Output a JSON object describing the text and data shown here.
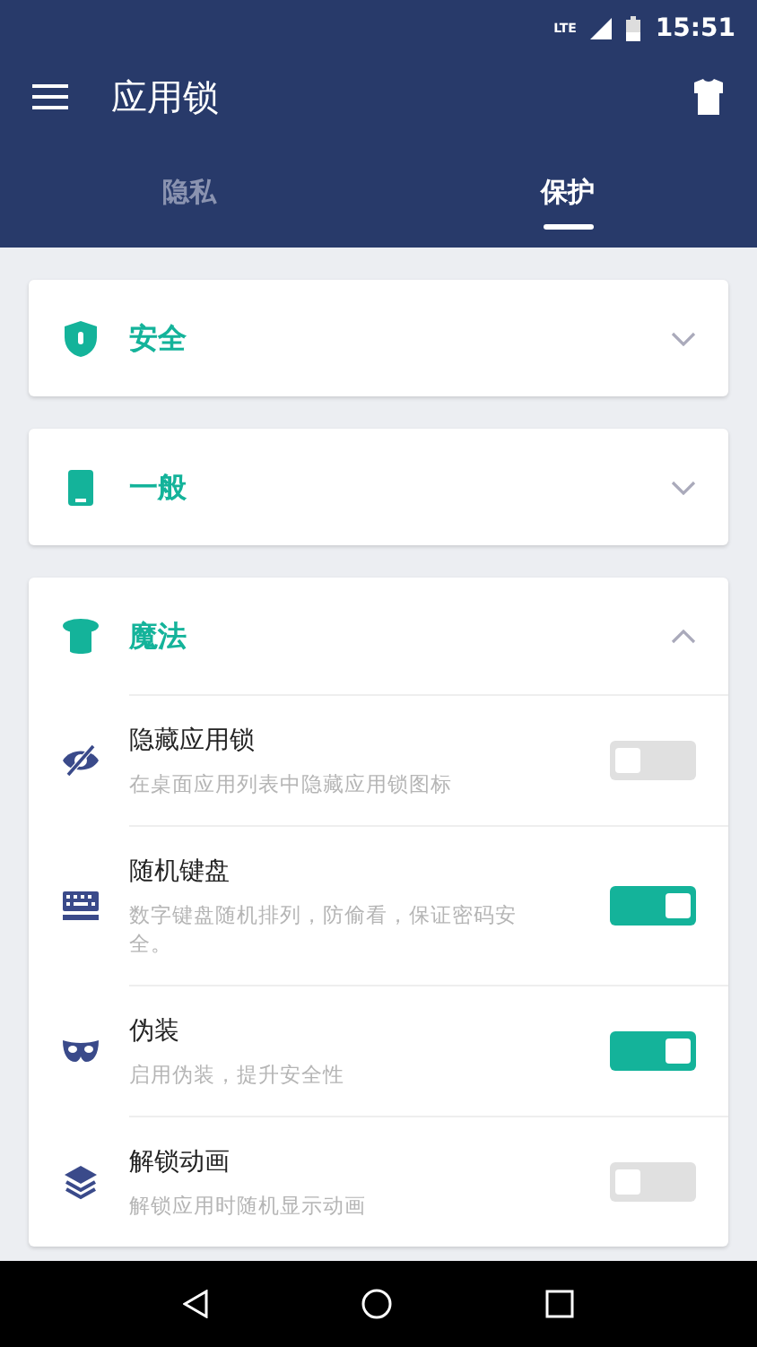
{
  "status_bar": {
    "network": "LTE",
    "time": "15:51"
  },
  "toolbar": {
    "title": "应用锁"
  },
  "tabs": [
    {
      "label": "隐私",
      "selected": false
    },
    {
      "label": "保护",
      "selected": true
    }
  ],
  "sections": [
    {
      "kind": "shield",
      "title": "安全",
      "expanded": false
    },
    {
      "kind": "phone",
      "title": "一般",
      "expanded": false
    },
    {
      "kind": "hat",
      "title": "魔法",
      "expanded": true,
      "items": [
        {
          "kind": "eye-off",
          "title": "隐藏应用锁",
          "description": "在桌面应用列表中隐藏应用锁图标",
          "on": false
        },
        {
          "kind": "keyboard",
          "title": "随机键盘",
          "description": "数字键盘随机排列，防偷看，保证密码安全。",
          "on": true
        },
        {
          "kind": "mask",
          "title": "伪装",
          "description": "启用伪装，提升安全性",
          "on": true
        },
        {
          "kind": "layers",
          "title": "解锁动画",
          "description": "解锁应用时随机显示动画",
          "on": false
        }
      ]
    }
  ]
}
